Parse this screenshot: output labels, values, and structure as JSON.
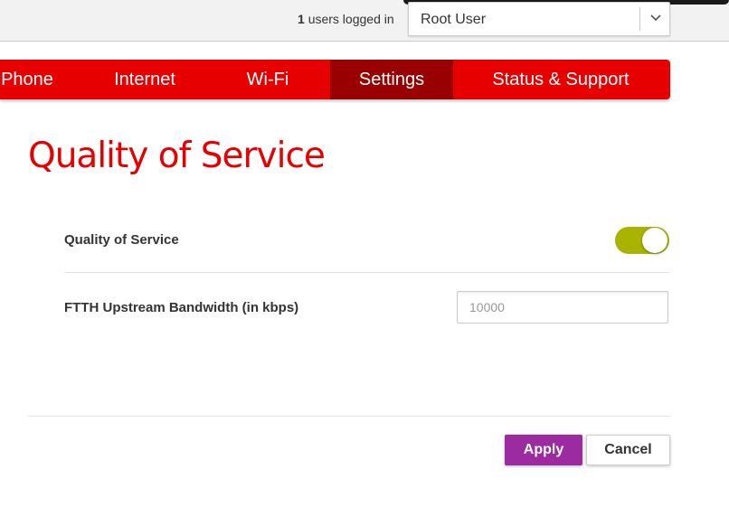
{
  "header": {
    "users_count": "1",
    "users_text": "users logged in",
    "user_select": {
      "selected": "Root User"
    }
  },
  "nav": {
    "items": [
      {
        "label": "Phone"
      },
      {
        "label": "Internet"
      },
      {
        "label": "Wi-Fi"
      },
      {
        "label": "Settings",
        "active": true
      },
      {
        "label": "Status & Support"
      }
    ]
  },
  "page": {
    "title": "Quality of Service"
  },
  "qos": {
    "label": "Quality of Service",
    "enabled": true
  },
  "bandwidth": {
    "label": "FTTH Upstream Bandwidth (in kbps)",
    "value": "",
    "placeholder": "10000"
  },
  "actions": {
    "apply_label": "Apply",
    "cancel_label": "Cancel"
  },
  "colors": {
    "brand_red": "#e60000",
    "active_tab": "#990000",
    "toggle_on": "#a8b400",
    "apply_button": "#9c2aa0"
  }
}
